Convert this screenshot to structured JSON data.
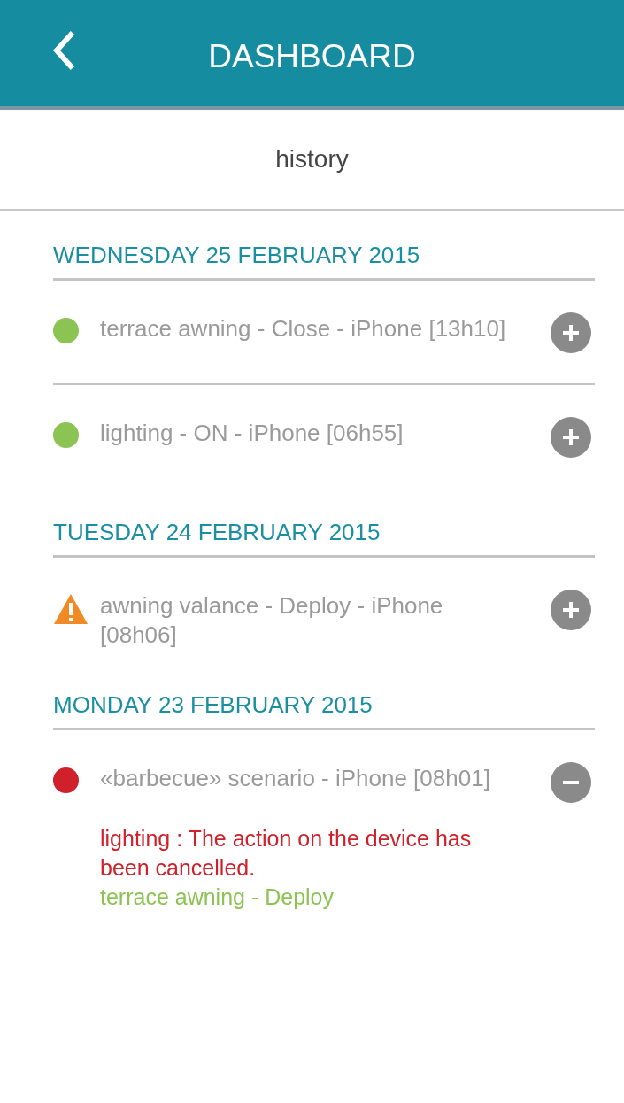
{
  "header": {
    "title": "DASHBOARD"
  },
  "subheader": {
    "title": "history"
  },
  "days": [
    {
      "date": "WEDNESDAY 25 FEBRUARY 2015",
      "entries": [
        {
          "kind": "ok",
          "text": "terrace awning - Close - iPhone [13h10]",
          "expanded": false
        },
        {
          "kind": "ok",
          "text": "lighting - ON - iPhone [06h55]",
          "expanded": false
        }
      ]
    },
    {
      "date": "TUESDAY 24 FEBRUARY 2015",
      "entries": [
        {
          "kind": "warning",
          "text": "awning valance - Deploy - iPhone [08h06]",
          "expanded": false
        }
      ]
    },
    {
      "date": "MONDAY 23 FEBRUARY 2015",
      "entries": [
        {
          "kind": "error",
          "text": "«barbecue» scenario - iPhone [08h01]",
          "expanded": true,
          "details": [
            {
              "text": "lighting : The action on the device has been cancelled.",
              "color": "#d0202a"
            },
            {
              "text": "terrace awning - Deploy",
              "color": "#8cc453"
            }
          ]
        }
      ]
    }
  ]
}
